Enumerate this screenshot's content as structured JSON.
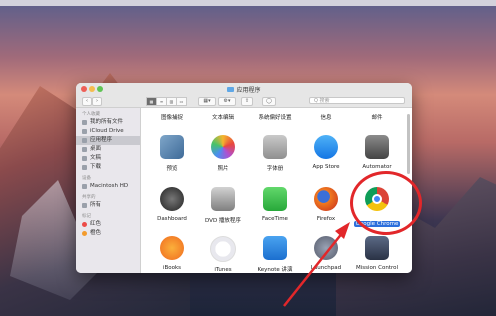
{
  "window": {
    "title": "应用程序"
  },
  "toolbar": {
    "back": "‹",
    "forward": "›",
    "search_placeholder": "Q 搜索"
  },
  "sidebar": {
    "sections": [
      {
        "title": "个人收藏",
        "items": [
          {
            "label": "我的所有文件",
            "icon": "all-files-icon"
          },
          {
            "label": "iCloud Drive",
            "icon": "cloud-icon"
          },
          {
            "label": "应用程序",
            "icon": "applications-icon",
            "selected": true
          },
          {
            "label": "桌面",
            "icon": "desktop-icon"
          },
          {
            "label": "文稿",
            "icon": "documents-icon"
          },
          {
            "label": "下载",
            "icon": "download-icon"
          }
        ]
      },
      {
        "title": "设备",
        "items": [
          {
            "label": "Macintosh HD",
            "icon": "disk-icon"
          }
        ]
      },
      {
        "title": "共享的",
        "items": [
          {
            "label": "所有",
            "icon": "network-icon"
          }
        ]
      },
      {
        "title": "标记",
        "items": [
          {
            "label": "红色",
            "color": "#ec4b47"
          },
          {
            "label": "橙色",
            "color": "#f39b2c"
          }
        ]
      }
    ]
  },
  "top_row_labels": [
    "图像捕捉",
    "文本编辑",
    "系统偏好设置",
    "信息",
    "邮件"
  ],
  "apps_row1": [
    {
      "label": "预览",
      "icon": "preview-icon"
    },
    {
      "label": "照片",
      "icon": "photos-icon"
    },
    {
      "label": "字体册",
      "icon": "font-book-icon"
    },
    {
      "label": "App Store",
      "icon": "app-store-icon"
    },
    {
      "label": "Automator",
      "icon": "automator-icon"
    }
  ],
  "apps_row2": [
    {
      "label": "Dashboard",
      "icon": "dashboard-icon"
    },
    {
      "label": "DVD 播放程序",
      "icon": "dvd-player-icon"
    },
    {
      "label": "FaceTime",
      "icon": "facetime-icon"
    },
    {
      "label": "Firefox",
      "icon": "firefox-icon"
    },
    {
      "label": "Google Chrome",
      "icon": "chrome-icon",
      "selected": true
    }
  ],
  "apps_row3": [
    {
      "label": "iBooks",
      "icon": "ibooks-icon"
    },
    {
      "label": "iTunes",
      "icon": "itunes-icon"
    },
    {
      "label": "Keynote 讲演",
      "icon": "keynote-icon"
    },
    {
      "label": "Launchpad",
      "icon": "launchpad-icon"
    },
    {
      "label": "Mission Control",
      "icon": "mission-control-icon"
    }
  ],
  "colors": {
    "annotation": "#e2272a",
    "selection": "#2d6fdc"
  }
}
